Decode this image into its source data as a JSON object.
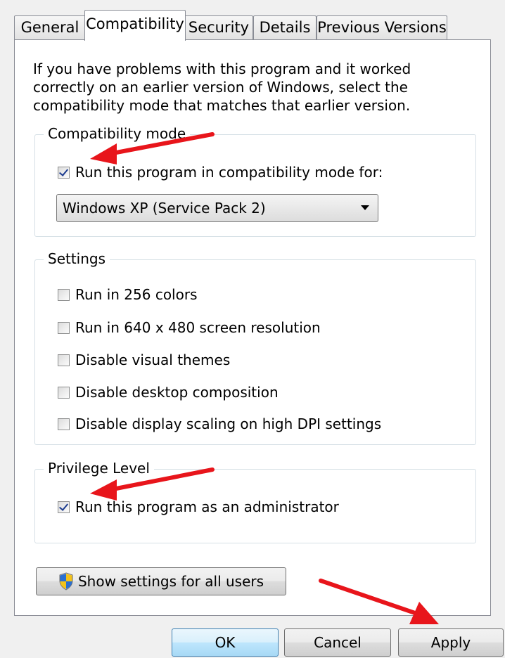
{
  "tabs": [
    {
      "label": "General"
    },
    {
      "label": "Compatibility"
    },
    {
      "label": "Security"
    },
    {
      "label": "Details"
    },
    {
      "label": "Previous Versions"
    }
  ],
  "active_tab": "Compatibility",
  "intro_text": "If you have problems with this program and it worked correctly on an earlier version of Windows, select the compatibility mode that matches that earlier version.",
  "compat_group": {
    "legend": "Compatibility mode",
    "checkbox_label": "Run this program in compatibility mode for:",
    "checked": true,
    "selected_mode": "Windows XP (Service Pack 2)"
  },
  "settings_group": {
    "legend": "Settings",
    "items": [
      {
        "label": "Run in 256 colors",
        "checked": false
      },
      {
        "label": "Run in 640 x 480 screen resolution",
        "checked": false
      },
      {
        "label": "Disable visual themes",
        "checked": false
      },
      {
        "label": "Disable desktop composition",
        "checked": false
      },
      {
        "label": "Disable display scaling on high DPI settings",
        "checked": false
      }
    ]
  },
  "privilege_group": {
    "legend": "Privilege Level",
    "checkbox_label": "Run this program as an administrator",
    "checked": true
  },
  "show_settings_button": "Show settings for all users",
  "footer_buttons": {
    "ok": "OK",
    "cancel": "Cancel",
    "apply": "Apply"
  },
  "colors": {
    "annotation_arrow": "#e8151b",
    "accent_check": "#1d3c8f"
  }
}
